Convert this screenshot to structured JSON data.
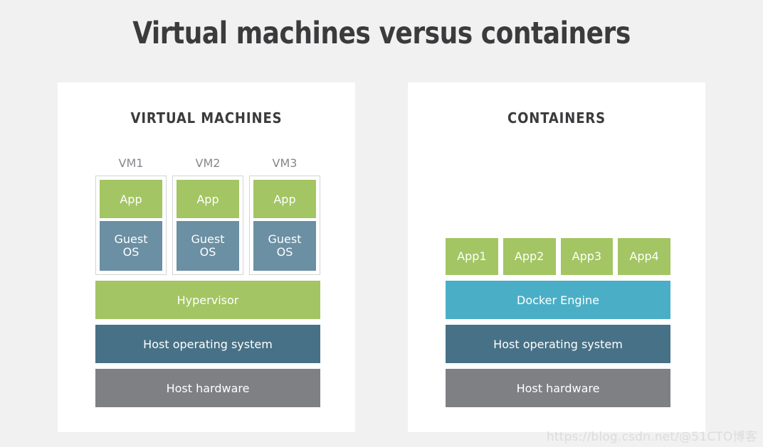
{
  "title": "Virtual machines versus containers",
  "colors": {
    "background": "#f1f1f1",
    "panel": "#ffffff",
    "green": "#a3c563",
    "guest_blue": "#6b8fa3",
    "docker_teal": "#4aafc6",
    "host_os_navy": "#477186",
    "hardware_gray": "#7e8084",
    "title_text": "#3b3b3d",
    "vm_label_text": "#85888c"
  },
  "left_panel": {
    "heading": "VIRTUAL MACHINES",
    "vms": [
      {
        "label": "VM1",
        "app": "App",
        "guest_os": "Guest\nOS"
      },
      {
        "label": "VM2",
        "app": "App",
        "guest_os": "Guest\nOS"
      },
      {
        "label": "VM3",
        "app": "App",
        "guest_os": "Guest\nOS"
      }
    ],
    "layers": [
      {
        "label": "Hypervisor",
        "color": "green"
      },
      {
        "label": "Host operating system",
        "color": "navy"
      },
      {
        "label": "Host hardware",
        "color": "gray"
      }
    ]
  },
  "right_panel": {
    "heading": "CONTAINERS",
    "apps": [
      {
        "name": "App",
        "number": "1"
      },
      {
        "name": "App",
        "number": "2"
      },
      {
        "name": "App",
        "number": "3"
      },
      {
        "name": "App",
        "number": "4"
      }
    ],
    "layers": [
      {
        "label": "Docker Engine",
        "color": "teal"
      },
      {
        "label": "Host operating system",
        "color": "navy"
      },
      {
        "label": "Host hardware",
        "color": "gray"
      }
    ]
  },
  "watermark": "https://blog.csdn.net/@51CTO博客"
}
